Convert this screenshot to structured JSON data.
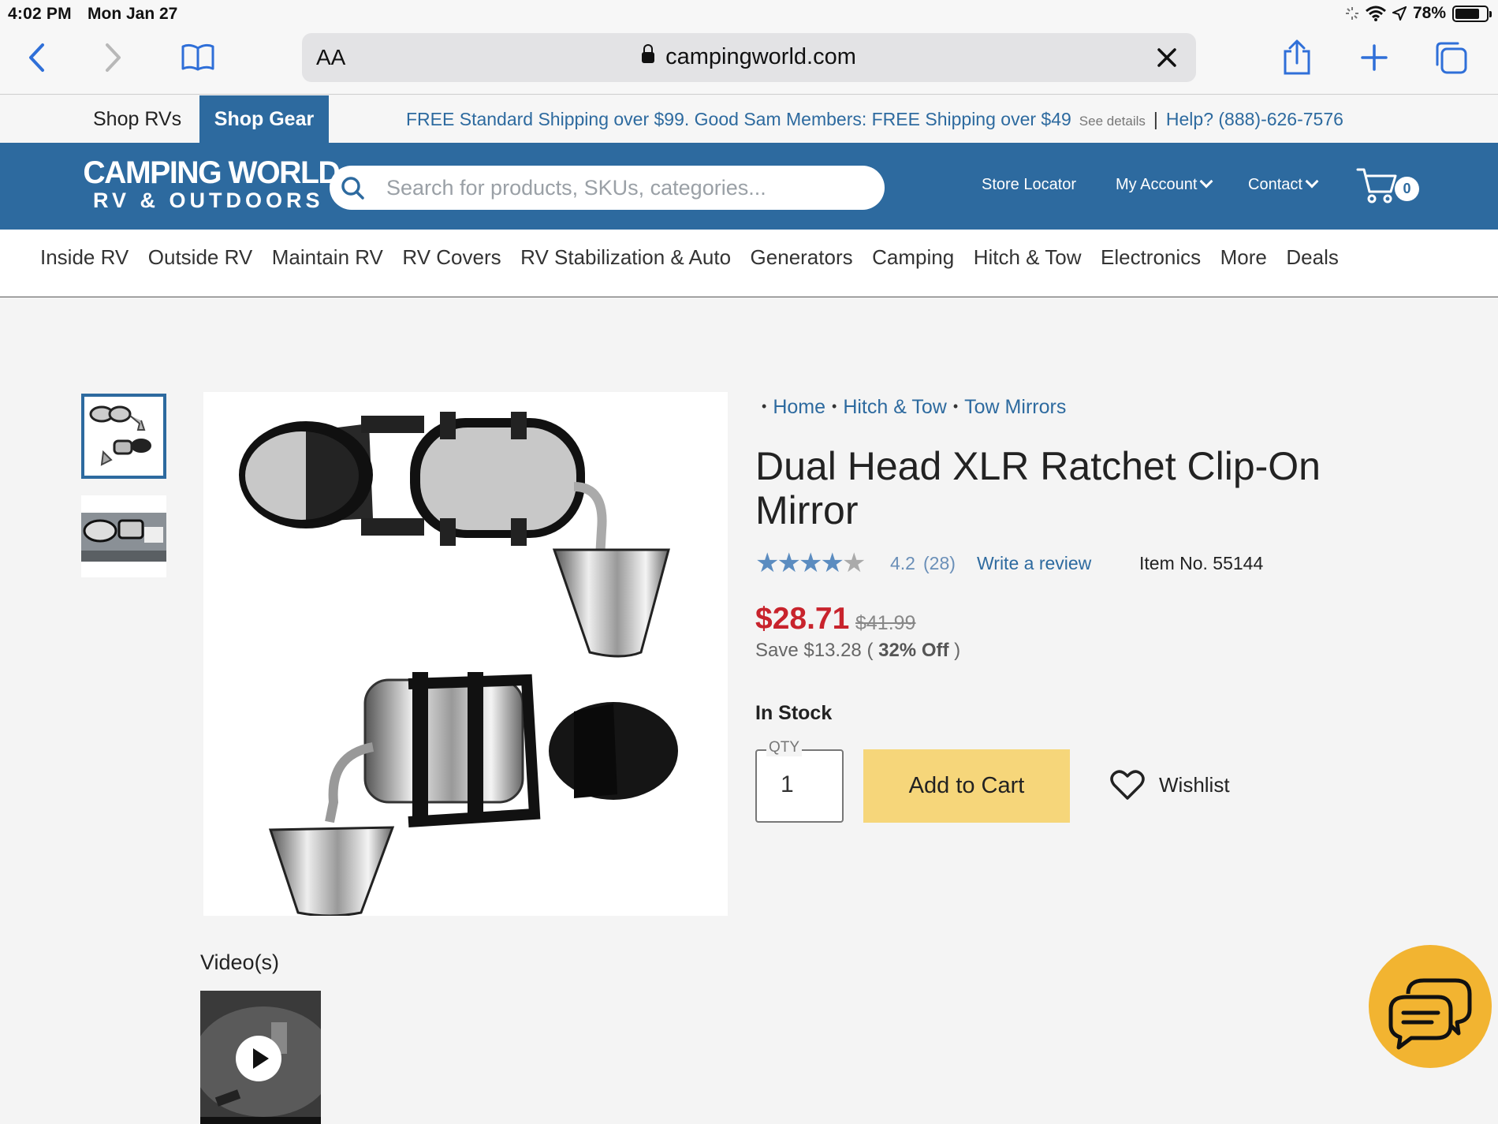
{
  "status_bar": {
    "time": "4:02 PM",
    "date": "Mon Jan 27",
    "battery": "78%",
    "battery_level": 0.78
  },
  "browser": {
    "aa_label": "AA",
    "url": "campingworld.com"
  },
  "site": {
    "tabs": {
      "shop_rvs": "Shop RVs",
      "shop_gear": "Shop Gear"
    },
    "shipping_message": "FREE Standard Shipping over $99. Good Sam Members: FREE Shipping over $49",
    "see_details": "See details",
    "separator": "|",
    "help": "Help? (888)-626-7576",
    "logo_line1": "CAMPING WORLD",
    "logo_line2": "RV & OUTDOORS",
    "search_placeholder": "Search for products, SKUs, categories...",
    "store_locator": "Store Locator",
    "my_account": "My Account",
    "contact": "Contact",
    "cart_count": "0",
    "brand_color": "#2d6a9f"
  },
  "categories": [
    "Inside RV",
    "Outside RV",
    "Maintain RV",
    "RV Covers",
    "RV Stabilization & Auto",
    "Generators",
    "Camping",
    "Hitch & Tow",
    "Electronics",
    "More",
    "Deals"
  ],
  "product": {
    "breadcrumb": [
      "Home",
      "Hitch & Tow",
      "Tow Mirrors"
    ],
    "title": "Dual Head XLR Ratchet Clip-On Mirror",
    "rating_value": 4.2,
    "rating": "4.2",
    "review_count": "(28)",
    "write_review": "Write a review",
    "item_number": "Item No. 55144",
    "price": "$28.71",
    "original_price": "$41.99",
    "save_amount": "Save $13.28 (",
    "save_percent": "32% Off",
    "save_close": ")",
    "stock_status": "In Stock",
    "qty_label": "QTY",
    "qty_value": "1",
    "add_to_cart": "Add to Cart",
    "wishlist": "Wishlist",
    "videos_label": "Video(s)",
    "price_color": "#c8232c",
    "cart_button_color": "#f6d67a"
  },
  "chat_button_color": "#f2b431"
}
